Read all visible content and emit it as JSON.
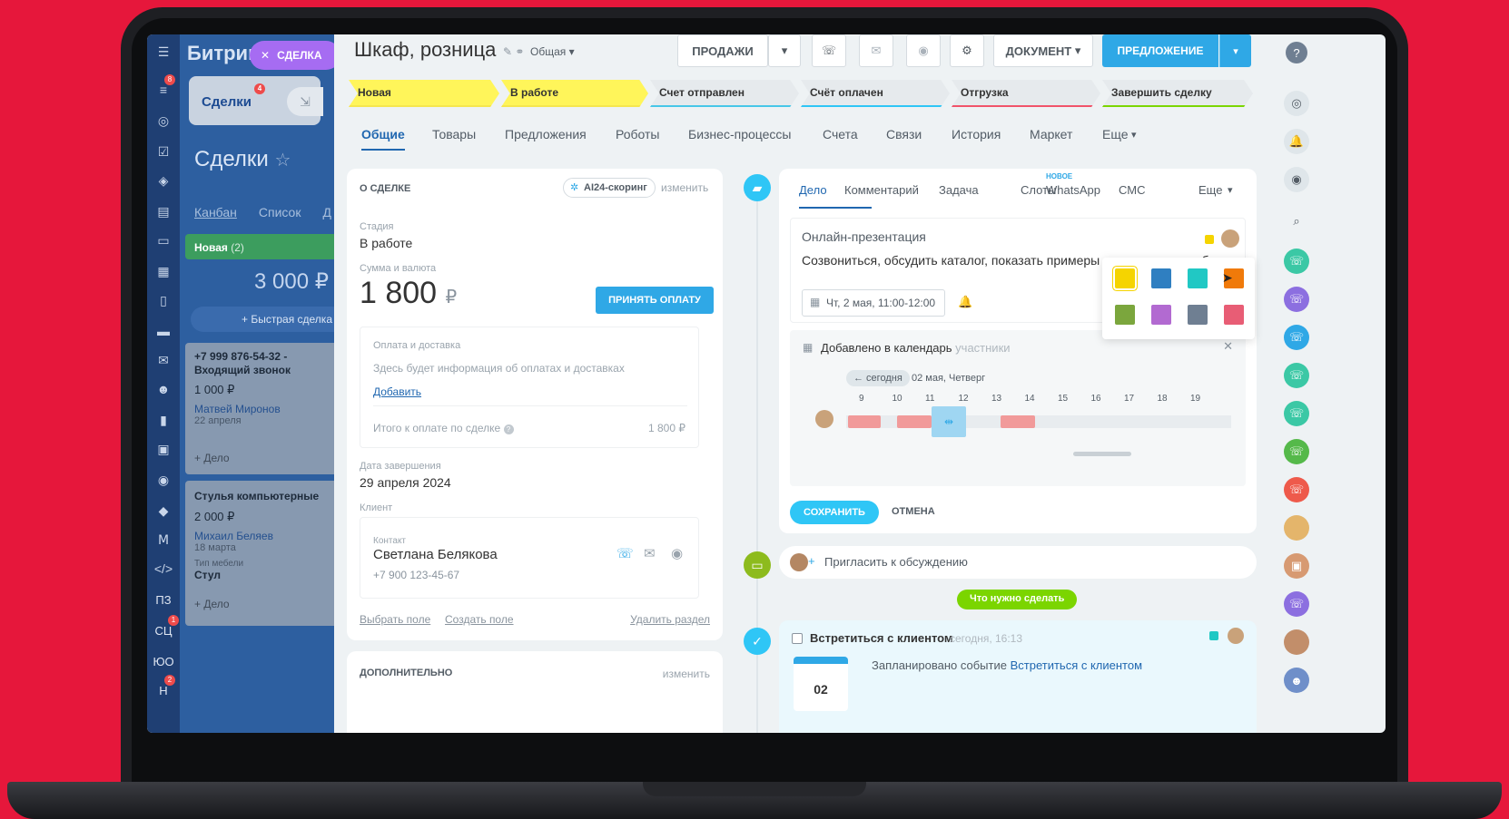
{
  "sidebar": {
    "brand": "Битрикс",
    "close_tag": "СДЕЛКА",
    "tab_deals": "Сделки",
    "tab_deals_badge": "4",
    "badge_top": "8",
    "badge_sc": "1",
    "badge_h": "2",
    "icon_text": [
      "ПЗ",
      "СЦ",
      "ЮО",
      "Н"
    ]
  },
  "behind": {
    "title": "Сделки",
    "views": [
      "Канбан",
      "Список",
      "Д"
    ],
    "column": "Новая",
    "column_count": "(2)",
    "column_sum": "3 000 ₽",
    "quick": "Быстрая сделка",
    "card1": {
      "title": "+7 999 876-54-32 - Входящий звонок",
      "sum": "1 000 ₽",
      "person": "Матвей Миронов",
      "date": "22 апреля",
      "action": "+ Дело"
    },
    "card2": {
      "title": "Стулья компьютерные",
      "sum": "2 000 ₽",
      "person": "Михаил Беляев",
      "date": "18 марта",
      "field_label": "Тип мебели",
      "field_value": "Стул",
      "action": "+ Дело"
    }
  },
  "header": {
    "title": "Шкаф, розница",
    "category": "Общая",
    "btn_sales": "ПРОДАЖИ",
    "btn_document": "ДОКУМЕНТ",
    "btn_offer": "ПРЕДЛОЖЕНИЕ",
    "help": "?"
  },
  "stages": [
    {
      "label": "Новая",
      "color": "#fff55a",
      "bar": "#f5e64e"
    },
    {
      "label": "В работе",
      "color": "#fff55a",
      "bar": "#f5e64e"
    },
    {
      "label": "Счет отправлен",
      "color": "#e6eaed",
      "bar": "#47c7e8"
    },
    {
      "label": "Счёт оплачен",
      "color": "#e6eaed",
      "bar": "#2fc6f6"
    },
    {
      "label": "Отгрузка",
      "color": "#e6eaed",
      "bar": "#f1536a"
    },
    {
      "label": "Завершить сделку",
      "color": "#e6eaed",
      "bar": "#7bd500"
    }
  ],
  "tabs": [
    "Общие",
    "Товары",
    "Предложения",
    "Роботы",
    "Бизнес-процессы",
    "Счета",
    "Связи",
    "История",
    "Маркет",
    "Еще"
  ],
  "about": {
    "heading": "О СДЕЛКЕ",
    "ai_badge": "AI24-скоринг",
    "edit": "изменить",
    "stage_label": "Стадия",
    "stage_value": "В работе",
    "sum_label": "Сумма и валюта",
    "sum_value": "1 800",
    "currency": "₽",
    "pay_button": "ПРИНЯТЬ ОПЛАТУ",
    "payment_title": "Оплата и доставка",
    "payment_info": "Здесь будет информация об оплатах и доставках",
    "add_link": "Добавить",
    "total_label": "Итого к оплате по сделке",
    "total_value": "1 800 ₽",
    "close_label": "Дата завершения",
    "close_value": "29 апреля 2024",
    "client_label": "Клиент",
    "contact_label": "Контакт",
    "contact_name": "Светлана Белякова",
    "contact_phone": "+7 900 123-45-67",
    "select_field": "Выбрать поле",
    "create_field": "Создать поле",
    "delete_section": "Удалить раздел",
    "extra_heading": "ДОПОЛНИТЕЛЬНО",
    "extra_edit": "изменить"
  },
  "activity": {
    "tabs": [
      "Дело",
      "Комментарий",
      "Задача",
      "Слоты",
      "WhatsApp",
      "СМС",
      "Еще"
    ],
    "new_badge": "НОВОЕ",
    "title": "Онлайн-презентация",
    "text": "Созвониться, обсудить каталог, показать примеры выполненных работ",
    "date": "Чт, 2 мая, 11:00-12:00",
    "cal_title": "Добавлено в календарь",
    "cal_participants": "участники",
    "today": "← сегодня",
    "cal_date": "02 мая, Четверг",
    "hours": [
      "9",
      "10",
      "11",
      "12",
      "13",
      "14",
      "15",
      "16",
      "17",
      "18",
      "19"
    ],
    "save": "СОХРАНИТЬ",
    "cancel": "ОТМЕНА",
    "swatches": [
      "#f5d400",
      "#2f7fc1",
      "#21c8c4",
      "#f07a0a",
      "#7ba63d",
      "#b26ad1",
      "#6f7f92",
      "#e85d75"
    ]
  },
  "timeline": {
    "invite": "Пригласить к обсуждению",
    "todo_badge": "Что нужно сделать",
    "task_title": "Встретиться с клиентом",
    "task_time": "сегодня, 16:13",
    "planned_label": "Запланировано событие",
    "planned_link": "Встретиться с клиентом",
    "cal_day": "02"
  }
}
